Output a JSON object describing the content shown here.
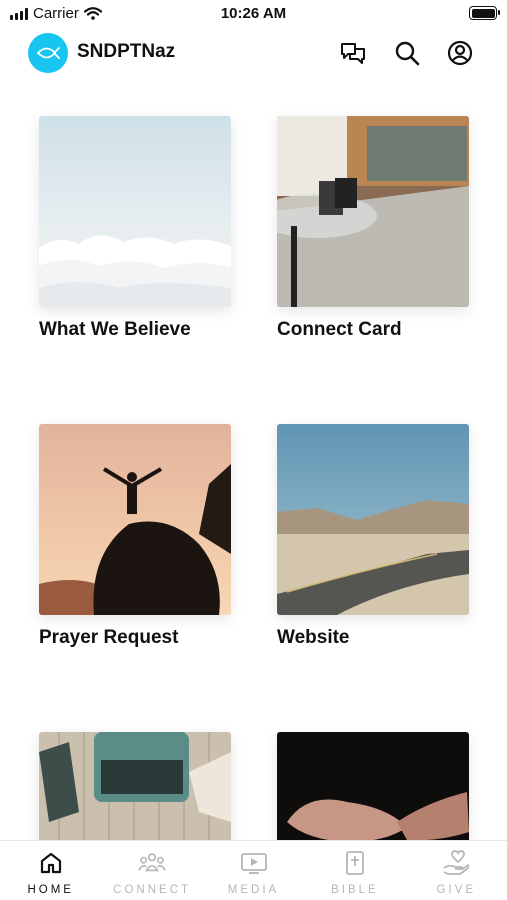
{
  "status_bar": {
    "carrier": "Carrier",
    "time": "10:26 AM"
  },
  "header": {
    "app_title": "SNDPTNaz",
    "icons": [
      "chat-icon",
      "search-icon",
      "account-icon"
    ],
    "accent_color": "#18c4f0"
  },
  "tiles": [
    {
      "label": "What We Believe",
      "image": "clouds-sky-photo"
    },
    {
      "label": "Connect Card",
      "image": "glass-table-rug-photo"
    },
    {
      "label": "Prayer Request",
      "image": "person-on-rock-sunset-photo"
    },
    {
      "label": "Website",
      "image": "desert-road-photo"
    },
    {
      "label": "",
      "image": "typewriter-photo"
    },
    {
      "label": "",
      "image": "open-hands-photo"
    }
  ],
  "tabbar": {
    "items": [
      {
        "label": "HOME",
        "icon": "home-icon",
        "active": true
      },
      {
        "label": "CONNECT",
        "icon": "people-icon",
        "active": false
      },
      {
        "label": "MEDIA",
        "icon": "play-screen-icon",
        "active": false
      },
      {
        "label": "BIBLE",
        "icon": "book-cross-icon",
        "active": false
      },
      {
        "label": "GIVE",
        "icon": "heart-hand-icon",
        "active": false
      }
    ]
  }
}
